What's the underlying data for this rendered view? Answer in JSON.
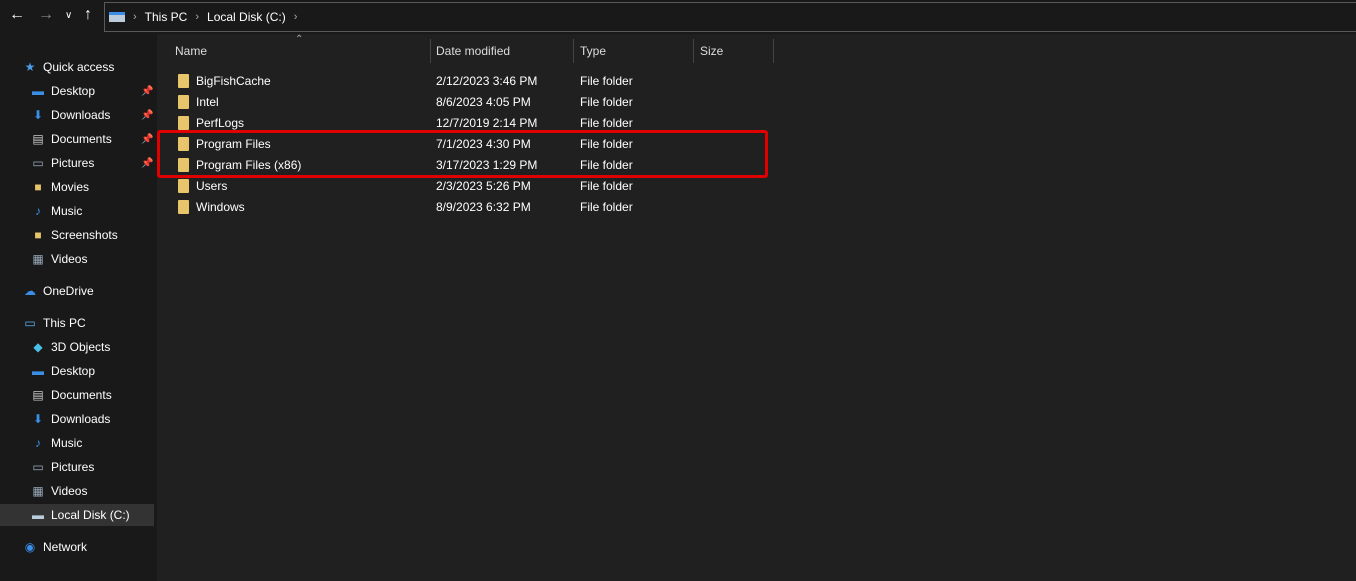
{
  "toolbar": {
    "back_icon": "arrow-left",
    "forward_icon": "arrow-right",
    "recent_icon": "chevron-down",
    "up_icon": "arrow-up"
  },
  "address": {
    "crumbs": [
      "This PC",
      "Local Disk (C:)"
    ]
  },
  "sidebar": {
    "items": [
      {
        "label": "Quick access",
        "icon": "star",
        "level": 0,
        "pinned": false
      },
      {
        "label": "Desktop",
        "icon": "desktop",
        "level": 1,
        "pinned": true
      },
      {
        "label": "Downloads",
        "icon": "download",
        "level": 1,
        "pinned": true
      },
      {
        "label": "Documents",
        "icon": "document",
        "level": 1,
        "pinned": true
      },
      {
        "label": "Pictures",
        "icon": "picture",
        "level": 1,
        "pinned": true
      },
      {
        "label": "Movies",
        "icon": "folder",
        "level": 1,
        "pinned": false
      },
      {
        "label": "Music",
        "icon": "music",
        "level": 1,
        "pinned": false
      },
      {
        "label": "Screenshots",
        "icon": "folder",
        "level": 1,
        "pinned": false
      },
      {
        "label": "Videos",
        "icon": "video",
        "level": 1,
        "pinned": false
      },
      {
        "label": "OneDrive",
        "icon": "cloud",
        "level": 0,
        "pinned": false,
        "gap": true
      },
      {
        "label": "This PC",
        "icon": "computer",
        "level": 0,
        "pinned": false,
        "gap": true
      },
      {
        "label": "3D Objects",
        "icon": "cube",
        "level": 1,
        "pinned": false
      },
      {
        "label": "Desktop",
        "icon": "desktop",
        "level": 1,
        "pinned": false
      },
      {
        "label": "Documents",
        "icon": "document",
        "level": 1,
        "pinned": false
      },
      {
        "label": "Downloads",
        "icon": "download",
        "level": 1,
        "pinned": false
      },
      {
        "label": "Music",
        "icon": "music",
        "level": 1,
        "pinned": false
      },
      {
        "label": "Pictures",
        "icon": "picture",
        "level": 1,
        "pinned": false
      },
      {
        "label": "Videos",
        "icon": "video",
        "level": 1,
        "pinned": false
      },
      {
        "label": "Local Disk (C:)",
        "icon": "drive",
        "level": 1,
        "pinned": false,
        "selected": true
      },
      {
        "label": "Network",
        "icon": "network",
        "level": 0,
        "pinned": false,
        "gap": true
      }
    ]
  },
  "columns": [
    "Name",
    "Date modified",
    "Type",
    "Size"
  ],
  "sort": {
    "column": "Name",
    "direction": "ascending"
  },
  "files": [
    {
      "name": "BigFishCache",
      "date": "2/12/2023 3:46 PM",
      "type": "File folder"
    },
    {
      "name": "Intel",
      "date": "8/6/2023 4:05 PM",
      "type": "File folder"
    },
    {
      "name": "PerfLogs",
      "date": "12/7/2019 2:14 PM",
      "type": "File folder"
    },
    {
      "name": "Program Files",
      "date": "7/1/2023 4:30 PM",
      "type": "File folder",
      "highlighted": true
    },
    {
      "name": "Program Files (x86)",
      "date": "3/17/2023 1:29 PM",
      "type": "File folder",
      "highlighted": true
    },
    {
      "name": "Users",
      "date": "2/3/2023 5:26 PM",
      "type": "File folder"
    },
    {
      "name": "Windows",
      "date": "8/9/2023 6:32 PM",
      "type": "File folder"
    }
  ],
  "colors": {
    "highlight": "#e00000",
    "folder": "#e8c46a",
    "selected": "#333333"
  }
}
